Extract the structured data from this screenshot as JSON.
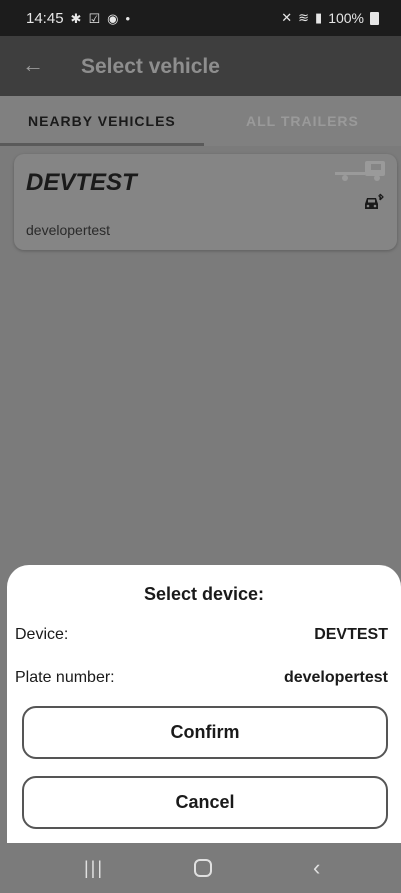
{
  "status_bar": {
    "time": "14:45",
    "left_icons": [
      "bluetooth-icon",
      "check-square-icon",
      "notification-icon",
      "dot-icon"
    ],
    "right_icons": [
      "mute-icon",
      "wifi-icon",
      "signal-icon",
      "battery-icon"
    ],
    "battery": "100%"
  },
  "app_bar": {
    "title": "Select vehicle",
    "back_icon": "arrow-left-icon"
  },
  "tabs": [
    {
      "label": "NEARBY VEHICLES",
      "active": true
    },
    {
      "label": "ALL TRAILERS",
      "active": false
    }
  ],
  "vehicles": [
    {
      "name": "DEVTEST",
      "plate": "developertest",
      "icons": [
        "trailer-truck-icon",
        "car-bluetooth-icon"
      ]
    }
  ],
  "dialog": {
    "title": "Select device:",
    "device_label": "Device:",
    "device_value": "DEVTEST",
    "plate_label": "Plate number:",
    "plate_value": "developertest",
    "confirm_label": "Confirm",
    "cancel_label": "Cancel"
  },
  "nav_bar": {
    "icons": [
      "recent-apps-icon",
      "home-icon",
      "back-icon"
    ]
  },
  "colors": {
    "status_bar": "#1c1c1c",
    "app_bar": "#3e3e3e",
    "scrim_background": "#7b7b7b",
    "sheet": "#ffffff",
    "button_border": "#555555"
  }
}
